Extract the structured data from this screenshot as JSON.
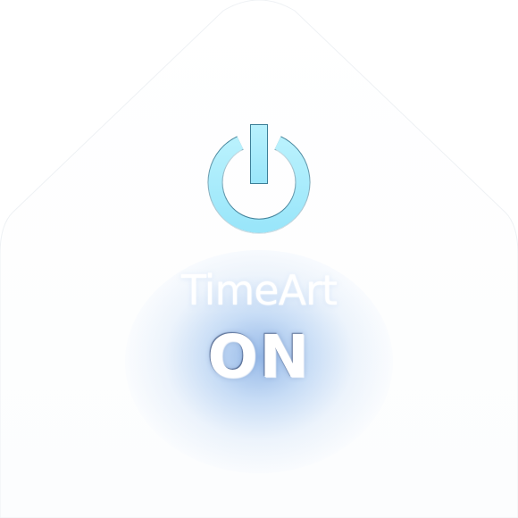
{
  "widget": {
    "brand_label": "TimeArt",
    "state_label": "ON",
    "power_icon": "power-icon"
  },
  "colors": {
    "power_fill": "#a6ecfb",
    "power_edge": "#4a8fa8",
    "glow": "#8fb4e6",
    "background": "#ffffff",
    "text": "#ffffff"
  }
}
